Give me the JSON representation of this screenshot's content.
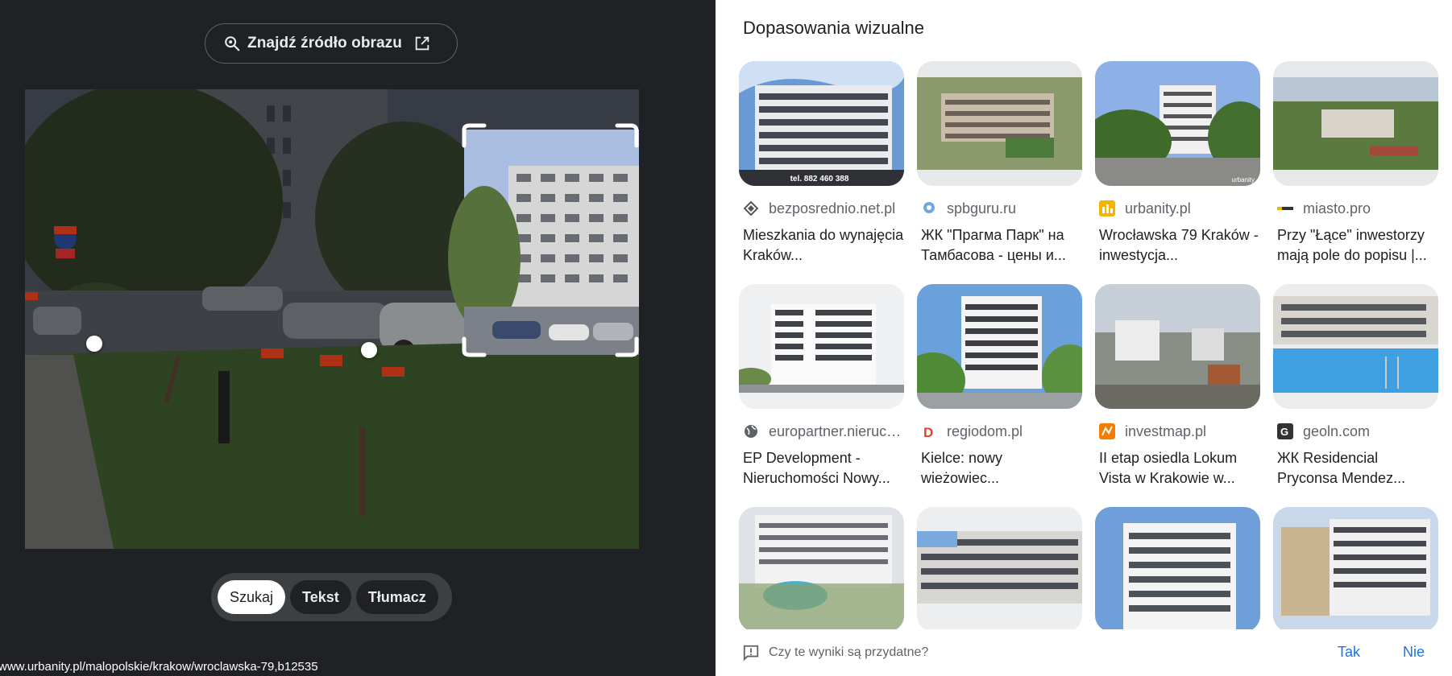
{
  "left_panel": {
    "find_source_label": "Znajdź źródło obrazu",
    "modes": [
      {
        "label": "Szukaj",
        "active": true
      },
      {
        "label": "Tekst",
        "active": false
      },
      {
        "label": "Tłumacz",
        "active": false
      }
    ],
    "status_url": "www.urbanity.pl/malopolskie/krakow/wroclawska-79,b12535"
  },
  "right_panel": {
    "title": "Dopasowania wizualne",
    "results": [
      {
        "source": "bezposrednio.net.pl",
        "title": "Mieszkania do wynajęcia Kraków...",
        "favicon": "diamond-favicon",
        "thumb_overlay": "tel. 882 460 388"
      },
      {
        "source": "spbguru.ru",
        "title": "ЖК \"Прагма Парк\" на Тамбасова - цены и...",
        "favicon": "pin-favicon"
      },
      {
        "source": "urbanity.pl",
        "title": "Wrocławska 79 Kraków - inwestycja...",
        "favicon": "bars-favicon",
        "thumb_overlay": "urbanity"
      },
      {
        "source": "miasto.pro",
        "title": "Przy \"Łące\" inwestorzy mają pole do popisu |...",
        "favicon": "dots-favicon"
      },
      {
        "source": "europartner.nieruchomosci.pl",
        "title": "EP Development - Nieruchomości Nowy...",
        "favicon": "globe-favicon"
      },
      {
        "source": "regiodom.pl",
        "title": "Kielce: nowy wieżowiec...",
        "favicon": "d-favicon"
      },
      {
        "source": "investmap.pl",
        "title": "II etap osiedla Lokum Vista w Krakowie w...",
        "favicon": "map-favicon"
      },
      {
        "source": "geoln.com",
        "title": "ЖК Residencial Pryconsa Mendez...",
        "favicon": "g-favicon"
      },
      {
        "source": "",
        "title": "",
        "favicon": ""
      },
      {
        "source": "",
        "title": "",
        "favicon": ""
      },
      {
        "source": "",
        "title": "",
        "favicon": ""
      },
      {
        "source": "",
        "title": "",
        "favicon": ""
      }
    ],
    "feedback": {
      "question": "Czy te wyniki są przydatne?",
      "yes": "Tak",
      "no": "Nie"
    }
  },
  "colors": {
    "dark_bg": "#202124",
    "accent_blue": "#1a73e8"
  }
}
